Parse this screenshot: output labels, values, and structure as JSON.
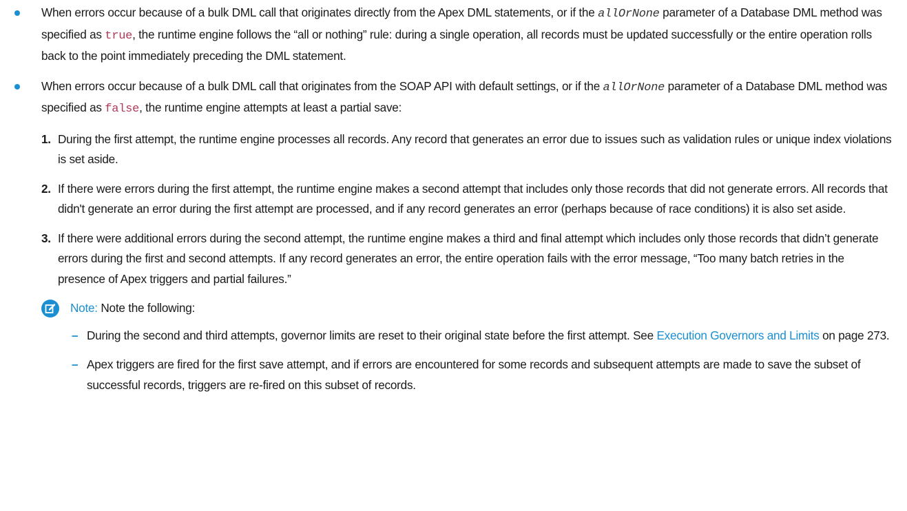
{
  "bullets": [
    {
      "t1": "When errors occur because of a bulk DML call that originates directly from the Apex DML statements, or if the ",
      "param": "allOrNone",
      "t2": " parameter of a Database DML method was specified as ",
      "code": "true",
      "t3": ", the runtime engine follows the “all or nothing” rule: during a single operation, all records must be updated successfully or the entire operation rolls back to the point immediately preceding the DML statement."
    },
    {
      "t1": "When errors occur because of a bulk DML call that originates from the SOAP API with default settings, or if the ",
      "param": "allOrNone",
      "t2": " parameter of a Database DML method was specified as ",
      "code": "false",
      "t3": ", the runtime engine attempts at least a partial save:"
    }
  ],
  "steps": [
    {
      "num": "1.",
      "text": "During the first attempt, the runtime engine processes all records. Any record that generates an error due to issues such as validation rules or unique index violations is set aside."
    },
    {
      "num": "2.",
      "text": "If there were errors during the first attempt, the runtime engine makes a second attempt that includes only those records that did not generate errors. All records that didn't generate an error during the first attempt are processed, and if any record generates an error (perhaps because of race conditions) it is also set aside."
    },
    {
      "num": "3.",
      "text": "If there were additional errors during the second attempt, the runtime engine makes a third and final attempt which includes only those records that didn’t generate errors during the first and second attempts. If any record generates an error, the entire operation fails with the error message, “Too many batch retries in the presence of Apex triggers and partial failures.”"
    }
  ],
  "note": {
    "icon": "edit-note-icon",
    "heading": "Note:",
    "intro": "Note the following:",
    "items": [
      {
        "dash": "–",
        "t1": "During the second and third attempts, governor limits are reset to their original state before the first attempt. See ",
        "link": "Execution Governors and Limits",
        "t2": " on page 273."
      },
      {
        "dash": "–",
        "t1": "Apex triggers are fired for the first save attempt, and if errors are encountered for some records and subsequent attempts are made to save the subset of successful records, triggers are re-fired on this subset of records.",
        "link": null,
        "t2": null
      }
    ]
  },
  "colors": {
    "accent": "#1b8fd2",
    "code": "#b23a5a"
  }
}
